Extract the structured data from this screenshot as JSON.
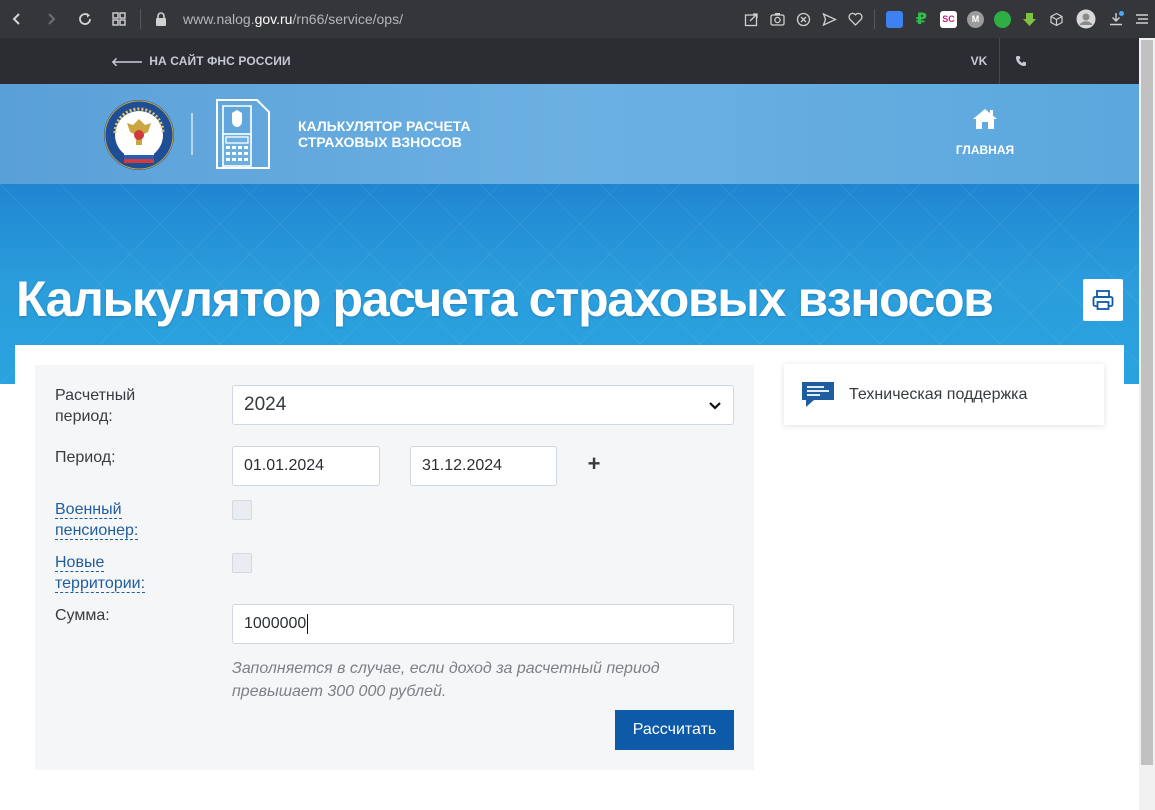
{
  "browser": {
    "url_prefix": "www.nalog.",
    "url_domain": "gov.ru",
    "url_path": "/rn66/service/ops/"
  },
  "topbar": {
    "back_link": "НА САЙТ ФНС РОССИИ",
    "vk_label": "VK"
  },
  "header": {
    "app_title_line1": "КАЛЬКУЛЯТОР РАСЧЕТА",
    "app_title_line2": "СТРАХОВЫХ ВЗНОСОВ",
    "home_label": "ГЛАВНАЯ"
  },
  "page": {
    "title": "Калькулятор расчета страховых взносов"
  },
  "form": {
    "period_label_line1": "Расчетный",
    "period_label_line2": "период:",
    "period_value": "2024",
    "range_label": "Период:",
    "date_from": "01.01.2024",
    "date_to": "31.12.2024",
    "add_label": "+",
    "military_label_line1": "Военный",
    "military_label_line2": "пенсионер:",
    "new_territories_label_line1": "Новые",
    "new_territories_label_line2": "территории:",
    "sum_label": "Сумма:",
    "sum_value": "1000000",
    "hint_line1": "Заполняется в случае, если доход за расчетный период",
    "hint_line2": "превышает 300 000 рублей.",
    "submit_label": "Рассчитать"
  },
  "support": {
    "label": "Техническая поддержка"
  },
  "colors": {
    "accent": "#0d5aa8",
    "banner": "#2b9ddc",
    "header": "#6cb0e2",
    "topstrip": "#2b2d33"
  }
}
